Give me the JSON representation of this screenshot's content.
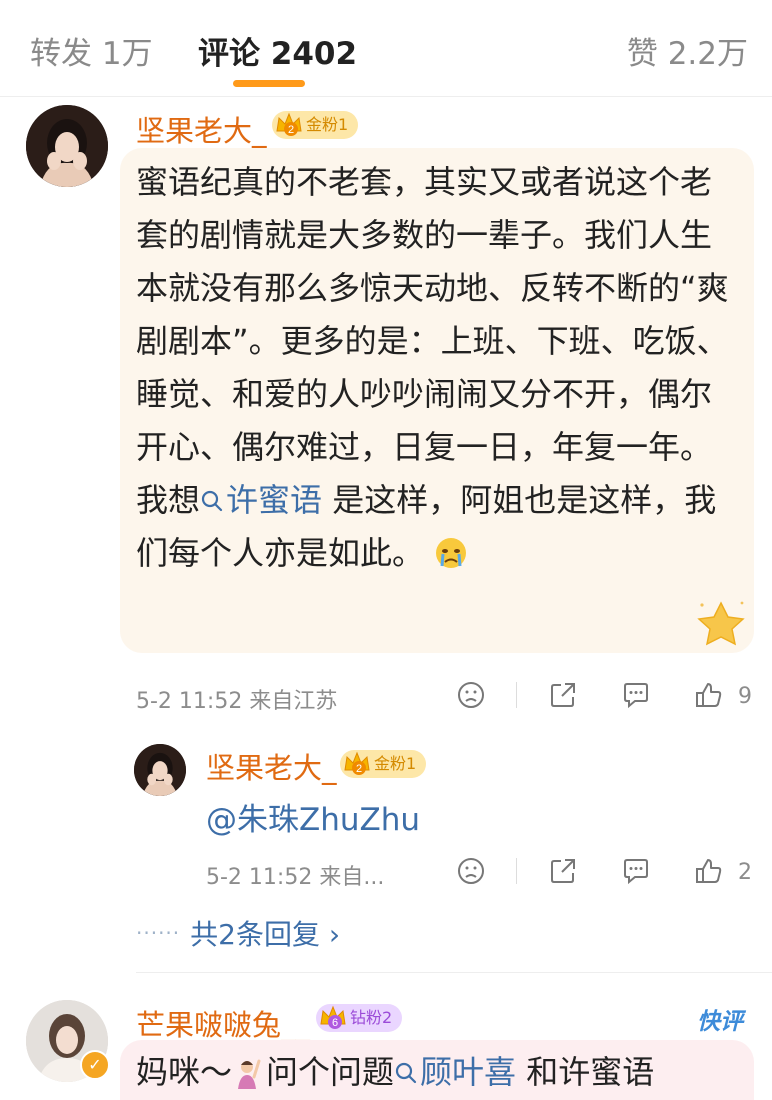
{
  "tabs": {
    "repost": "转发 1万",
    "comments": "评论 2402",
    "likes": "赞 2.2万"
  },
  "comment_main": {
    "username": "坚果老大_",
    "fan_badge_level": "2",
    "fan_badge_text": "金粉1",
    "text_before_link": "蜜语纪真的不老套，其实又或者说这个老套的剧情就是大多数的一辈子。我们人生本就没有那么多惊天动地、反转不断的“爽剧剧本”。更多的是：上班、下班、吃饭、睡觉、和爱的人吵吵闹闹又分不开，偶尔开心、偶尔难过，日复一日，年复一年。 我想",
    "topic_link": "许蜜语",
    "text_after_link": " 是这样，阿姐也是这样，我们每个人亦是如此。",
    "emoji": "crying-emoji",
    "time": "5-2 11:52",
    "location": "来自江苏",
    "like_count": "9"
  },
  "reply": {
    "username": "坚果老大_",
    "fan_badge_level": "2",
    "fan_badge_text": "金粉1",
    "text": "@朱珠ZhuZhu",
    "time": "5-2 11:52",
    "location": "来自...",
    "like_count": "2"
  },
  "more_replies": {
    "dots": "······",
    "label": "共2条回复",
    "chevron": "›"
  },
  "comment_third": {
    "username": "芒果啵啵兔__",
    "fan_badge_level": "6",
    "fan_badge_text": "钻粉2",
    "quick_label": "快评",
    "text_start": "妈咪～",
    "text_mid": "问个问题",
    "topic_link": "顾叶喜",
    "text_end": " 和许蜜语"
  },
  "colors": {
    "accent": "#ff9a1a",
    "username": "#e06a12",
    "link": "#3d6ea8",
    "meta": "#8c8c8c",
    "bubble": "#fdf6ec"
  }
}
